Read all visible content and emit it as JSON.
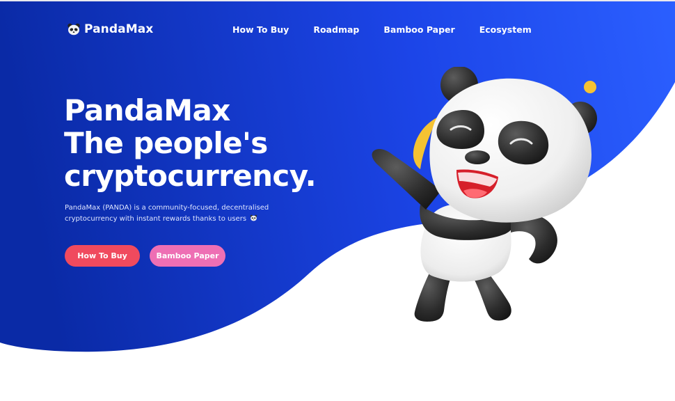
{
  "brand": {
    "name": "PandaMax",
    "icon": "panda-head-icon"
  },
  "nav": {
    "items": [
      {
        "label": "How To Buy"
      },
      {
        "label": "Roadmap"
      },
      {
        "label": "Bamboo Paper"
      },
      {
        "label": "Ecosystem"
      }
    ]
  },
  "hero": {
    "headline_lines": [
      "PandaMax",
      "The people's",
      "cryptocurrency."
    ],
    "description_line1": "PandaMax (PANDA) is a community-focused, decentralised",
    "description_line2": "cryptocurrency with instant rewards thanks to users",
    "description_icon": "panda-emoji-icon",
    "buttons": {
      "primary_label": "How To Buy",
      "secondary_label": "Bamboo Paper"
    },
    "illustration": "waving-panda-3d"
  },
  "colors": {
    "gradient_start": "#0a2aa6",
    "gradient_end": "#2a5cff",
    "primary_button": "#f04a5e",
    "secondary_button": "#ee6fb4",
    "accent_yellow": "#f6c233"
  }
}
